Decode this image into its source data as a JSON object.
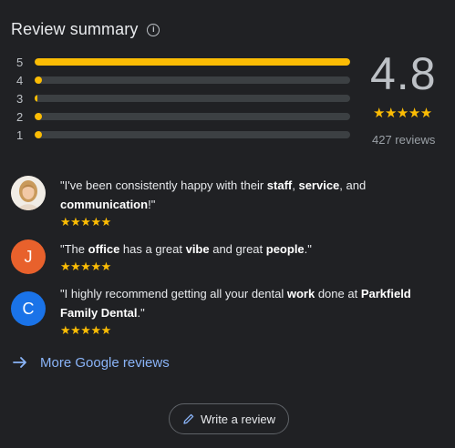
{
  "header": {
    "title": "Review summary",
    "info_glyph": "i"
  },
  "rating_bars": [
    {
      "label": "5",
      "fill_fraction": 1.0
    },
    {
      "label": "4",
      "fill_fraction": 0.02
    },
    {
      "label": "3",
      "fill_fraction": 0.008
    },
    {
      "label": "2",
      "fill_fraction": 0.01
    },
    {
      "label": "1",
      "fill_fraction": 0.02
    }
  ],
  "summary": {
    "score": "4.8",
    "stars": "★★★★★",
    "review_count": "427 reviews"
  },
  "reviews": [
    {
      "avatar_type": "photo",
      "avatar_letter": "",
      "avatar_color": "#d9d2c8",
      "text_parts": [
        {
          "t": "\"I've been consistently happy with their ",
          "b": false
        },
        {
          "t": "staff",
          "b": true
        },
        {
          "t": ", ",
          "b": false
        },
        {
          "t": "service",
          "b": true
        },
        {
          "t": ", and ",
          "b": false
        },
        {
          "t": "communication",
          "b": true
        },
        {
          "t": "!\"",
          "b": false
        }
      ],
      "stars": "★★★★★"
    },
    {
      "avatar_type": "letter",
      "avatar_letter": "J",
      "avatar_color": "#e8612c",
      "text_parts": [
        {
          "t": "\"The ",
          "b": false
        },
        {
          "t": "office",
          "b": true
        },
        {
          "t": " has a great ",
          "b": false
        },
        {
          "t": "vibe",
          "b": true
        },
        {
          "t": " and great ",
          "b": false
        },
        {
          "t": "people",
          "b": true
        },
        {
          "t": ".\"",
          "b": false
        }
      ],
      "stars": "★★★★★"
    },
    {
      "avatar_type": "letter",
      "avatar_letter": "C",
      "avatar_color": "#1a73e8",
      "text_parts": [
        {
          "t": "\"I highly recommend getting all your dental ",
          "b": false
        },
        {
          "t": "work",
          "b": true
        },
        {
          "t": " done at ",
          "b": false
        },
        {
          "t": "Parkfield Family Dental",
          "b": true
        },
        {
          "t": ".\"",
          "b": false
        }
      ],
      "stars": "★★★★★"
    }
  ],
  "more_link": {
    "label": "More Google reviews",
    "icon": "arrow-right-icon"
  },
  "write_button": {
    "label": "Write a review",
    "icon": "pencil-icon"
  },
  "colors": {
    "background": "#202124",
    "star": "#fbbc04",
    "bar_track": "#3c4043",
    "link": "#8ab4f8"
  }
}
